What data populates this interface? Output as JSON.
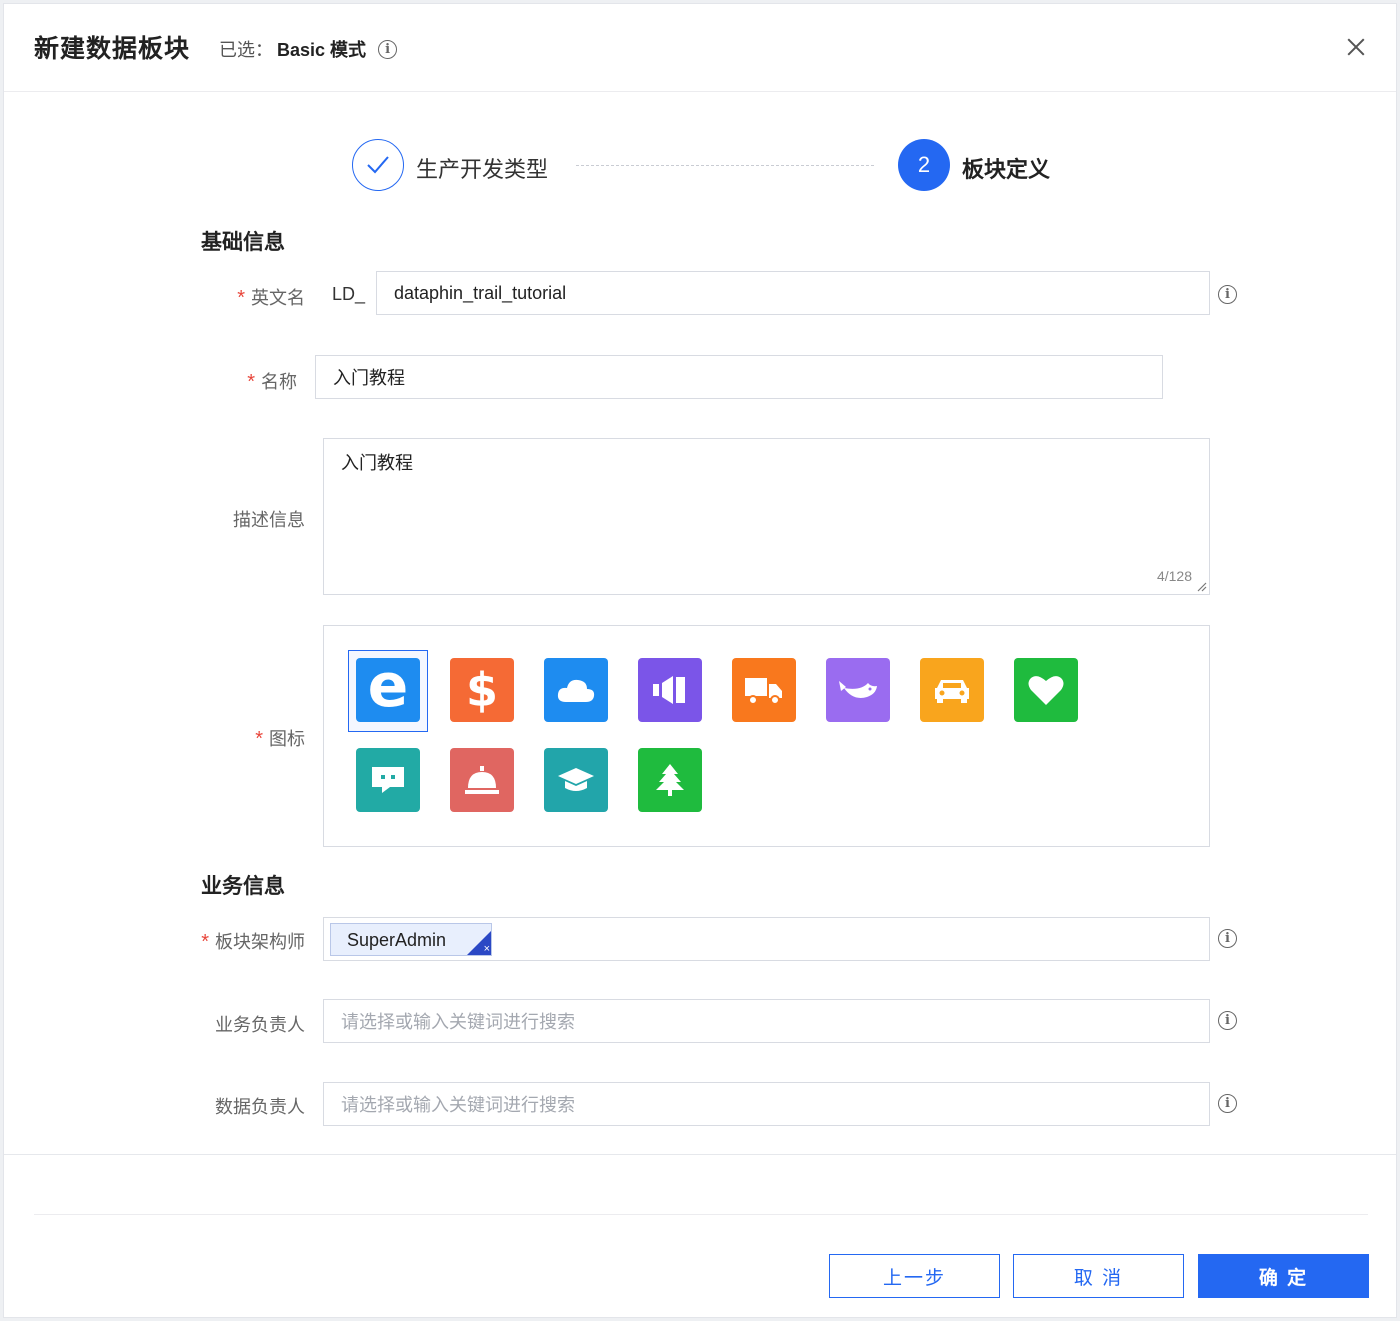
{
  "dialog": {
    "title": "新建数据板块",
    "selected_prefix": "已选：",
    "selected_mode": "Basic 模式"
  },
  "steps": [
    {
      "label": "生产开发类型",
      "status": "done"
    },
    {
      "number": "2",
      "label": "板块定义",
      "status": "active"
    }
  ],
  "basic": {
    "section": "基础信息",
    "english_name": {
      "label": "英文名",
      "prefix": "LD_",
      "value": "dataphin_trail_tutorial"
    },
    "name": {
      "label": "名称",
      "value": "入门教程"
    },
    "description": {
      "label": "描述信息",
      "value": "入门教程",
      "counter": "4/128"
    },
    "icon": {
      "label": "图标",
      "options": [
        {
          "name": "ie-browser-icon",
          "color": "#1e8cf0"
        },
        {
          "name": "dollar-icon",
          "color": "#f56a35"
        },
        {
          "name": "cloud-icon",
          "color": "#1e8cf0"
        },
        {
          "name": "speaker-icon",
          "color": "#7b55e8"
        },
        {
          "name": "truck-icon",
          "color": "#f9781d"
        },
        {
          "name": "whale-icon",
          "color": "#9a6cf0"
        },
        {
          "name": "car-icon",
          "color": "#f9a51d"
        },
        {
          "name": "heart-icon",
          "color": "#1fbb3e"
        },
        {
          "name": "chat-icon",
          "color": "#22aaa5"
        },
        {
          "name": "service-bell-icon",
          "color": "#e06661"
        },
        {
          "name": "graduation-cap-icon",
          "color": "#22a5aa"
        },
        {
          "name": "tree-icon",
          "color": "#1fbb3e"
        }
      ],
      "selected_index": 0
    }
  },
  "business": {
    "section": "业务信息",
    "architect": {
      "label": "板块架构师",
      "tag": "SuperAdmin"
    },
    "business_owner": {
      "label": "业务负责人",
      "placeholder": "请选择或输入关键词进行搜索"
    },
    "data_owner": {
      "label": "数据负责人",
      "placeholder": "请选择或输入关键词进行搜索"
    }
  },
  "footer": {
    "prev": "上一步",
    "cancel": "取 消",
    "confirm": "确 定"
  },
  "colors": {
    "primary": "#2468f2",
    "required": "#e8463b"
  }
}
